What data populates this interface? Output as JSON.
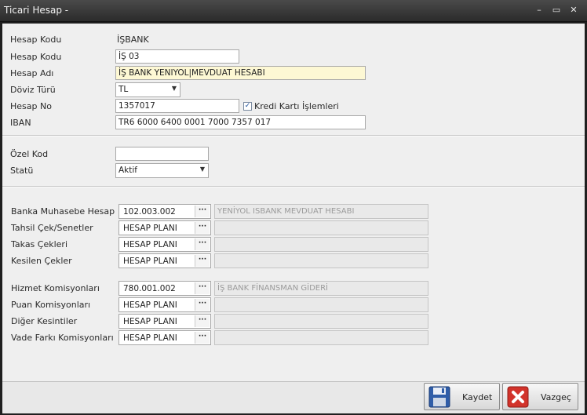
{
  "window": {
    "title": "Ticari Hesap -",
    "minimize": "–",
    "maximize": "▭",
    "close": "✕"
  },
  "top": {
    "kod_label1": "Hesap Kodu",
    "kod_value_static": "İŞBANK",
    "kod_label2": "Hesap Kodu",
    "kod_value": "İŞ 03",
    "adi_label": "Hesap Adı",
    "adi_value": "İŞ BANK YENIYOL|MEVDUAT HESABI",
    "doviz_label": "Döviz Türü",
    "doviz_value": "TL",
    "no_label": "Hesap No",
    "no_value": "1357017",
    "kredi_label": "Kredi Kartı İşlemleri",
    "kredi_checked": "✓",
    "iban_label": "IBAN",
    "iban_value": "TR6 6000 6400 0001 7000 7357 017"
  },
  "mid": {
    "ozel_label": "Özel Kod",
    "ozel_value": "",
    "statu_label": "Statü",
    "statu_value": "Aktif"
  },
  "accounts": [
    {
      "label": "Banka Muhasebe Hesap",
      "code": "102.003.002",
      "desc": "YENİYOL ISBANK MEVDUAT HESABI"
    },
    {
      "label": "Tahsil Çek/Senetler",
      "code": "HESAP PLANI",
      "desc": ""
    },
    {
      "label": "Takas Çekleri",
      "code": "HESAP PLANI",
      "desc": ""
    },
    {
      "label": "Kesilen Çekler",
      "code": "HESAP PLANI",
      "desc": ""
    },
    {
      "label": "Hizmet Komisyonları",
      "code": "780.001.002",
      "desc": "İŞ BANK FİNANSMAN GİDERİ"
    },
    {
      "label": "Puan Komisyonları",
      "code": "HESAP PLANI",
      "desc": ""
    },
    {
      "label": "Diğer Kesintiler",
      "code": "HESAP PLANI",
      "desc": ""
    },
    {
      "label": "Vade Farkı Komisyonları",
      "code": "HESAP PLANI",
      "desc": ""
    }
  ],
  "lookup_dots": "···",
  "buttons": {
    "save": "Kaydet",
    "cancel": "Vazgeç"
  }
}
